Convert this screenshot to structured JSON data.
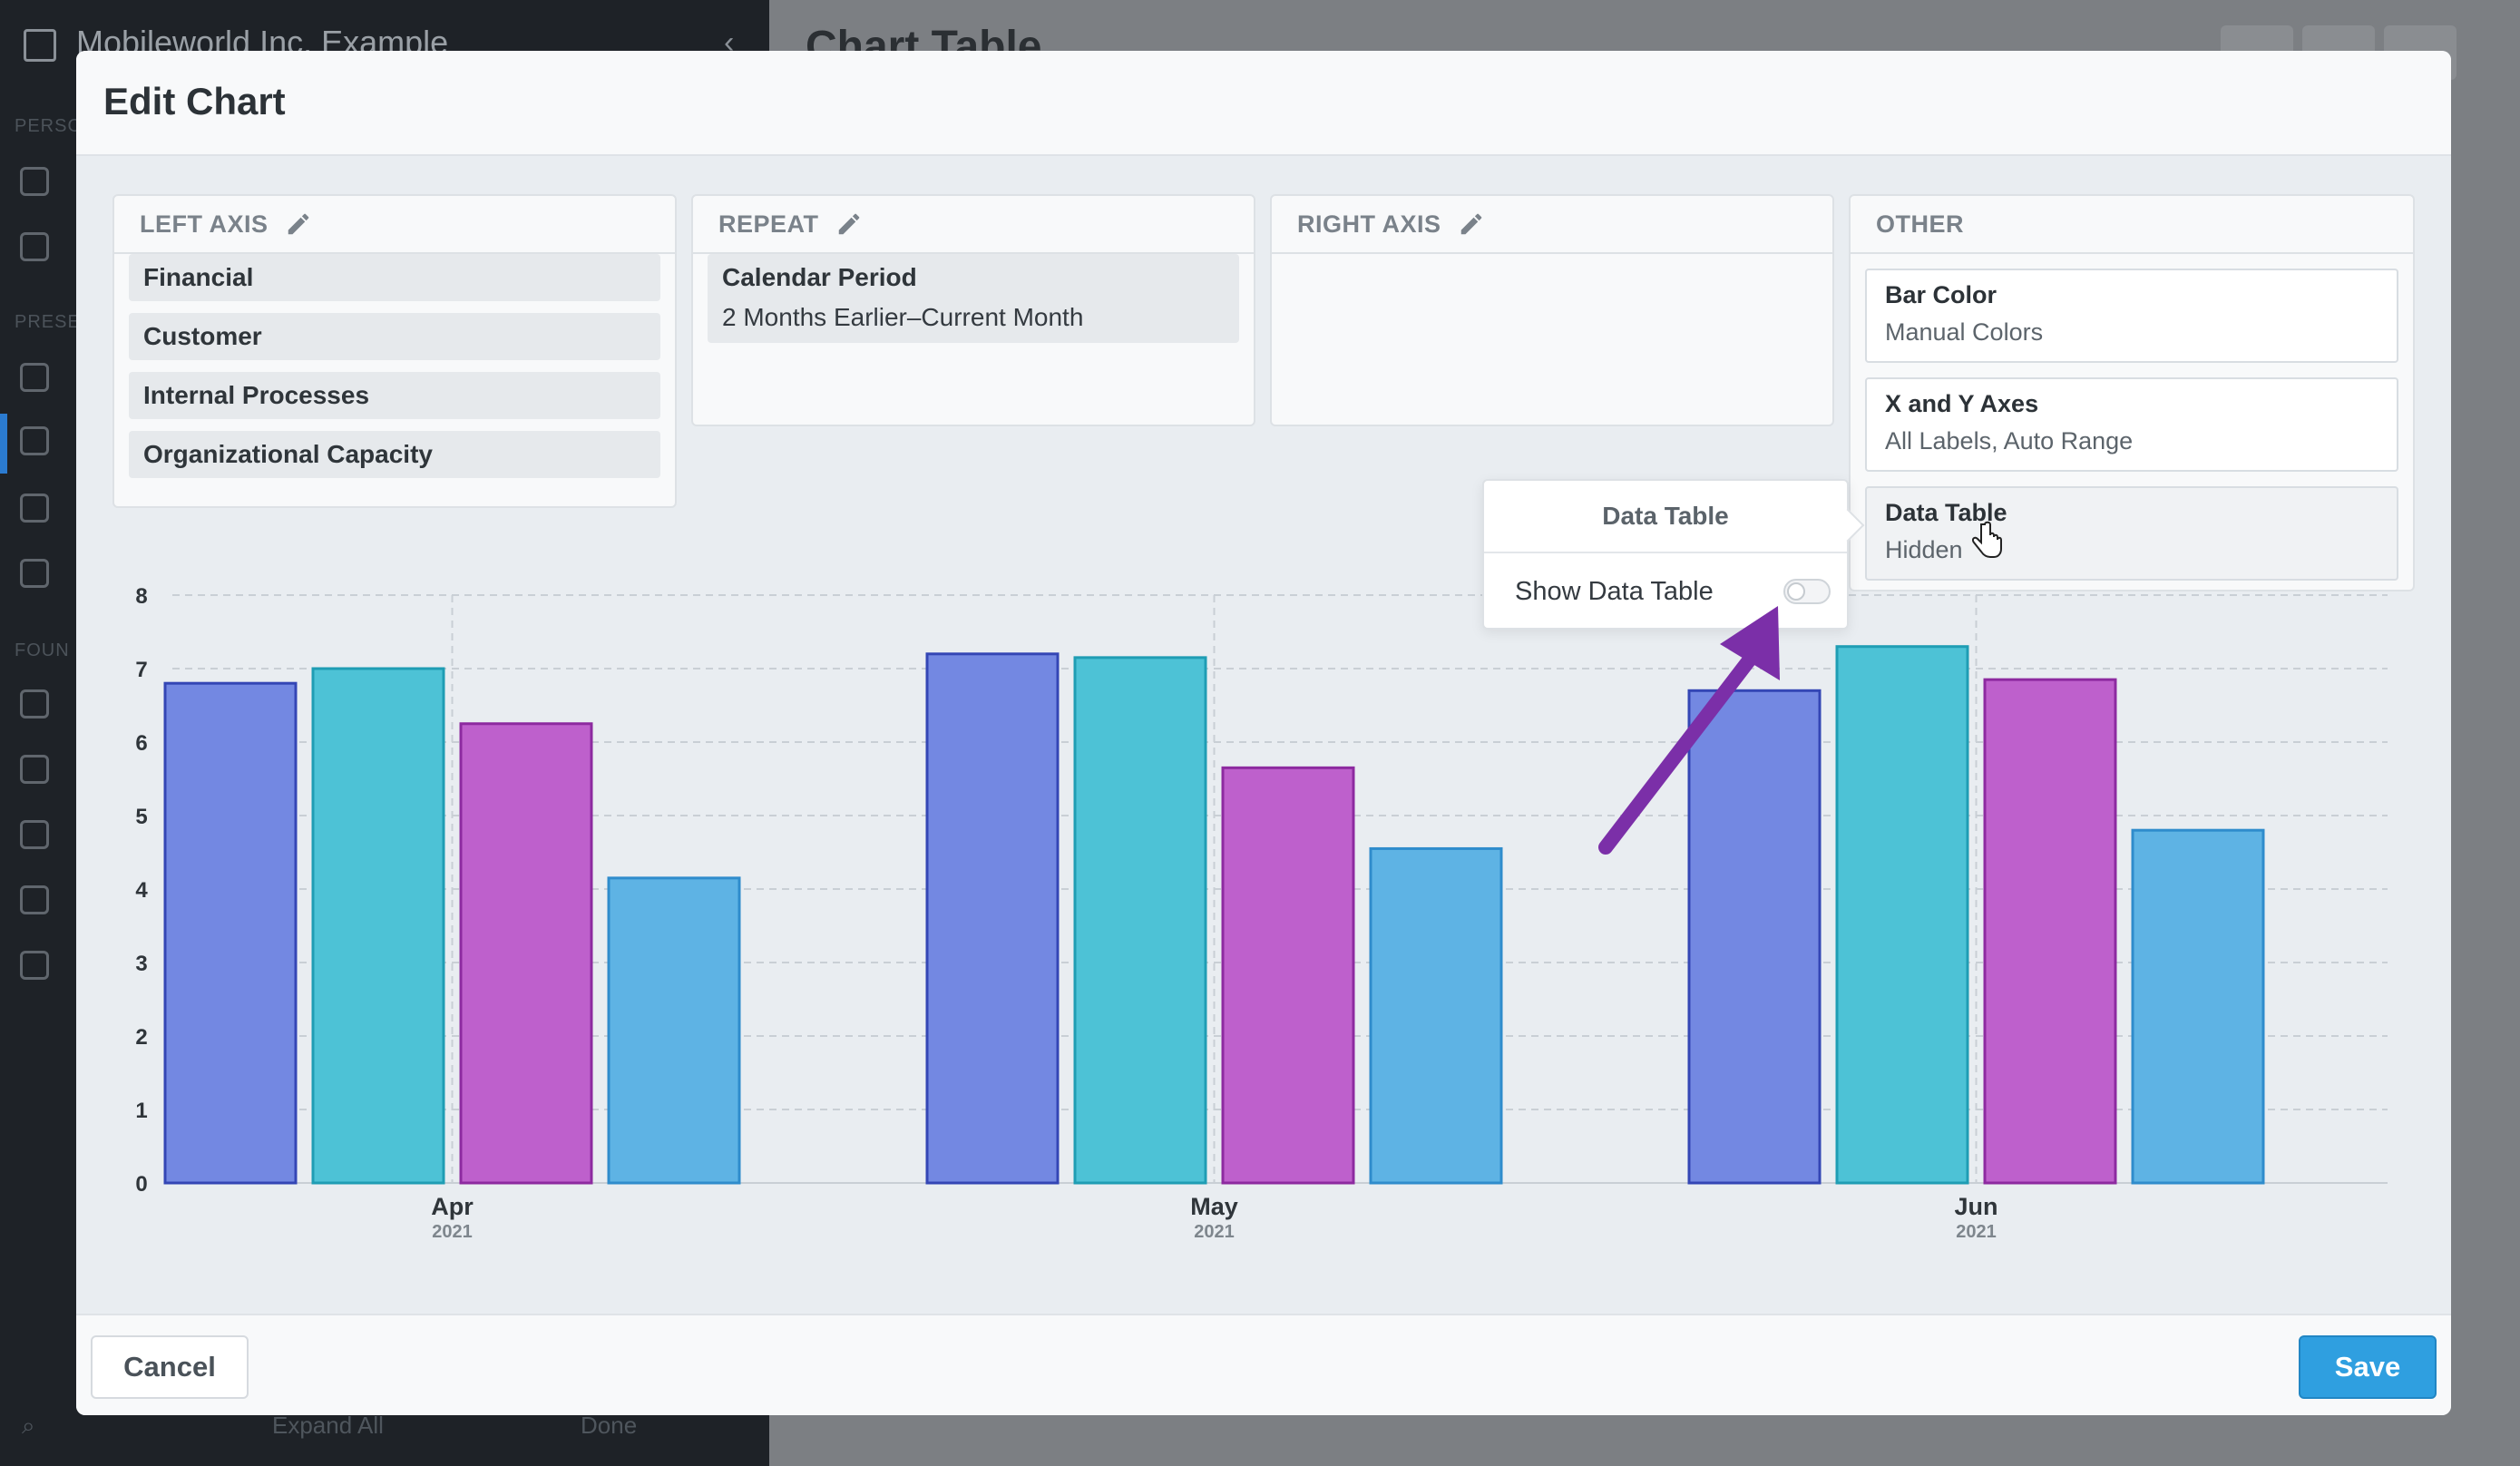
{
  "background": {
    "company_name": "Mobileworld Inc. Example",
    "page_title": "Chart Table",
    "sidebar_sections": [
      "PERSO",
      "PRESE",
      "FOUN"
    ],
    "bottom_expand": "Expand All",
    "bottom_done": "Done"
  },
  "modal": {
    "title": "Edit Chart",
    "cancel_label": "Cancel",
    "save_label": "Save"
  },
  "panels": {
    "left_axis": {
      "title": "LEFT AXIS",
      "items": [
        "Financial",
        "Customer",
        "Internal Processes",
        "Organizational Capacity"
      ]
    },
    "repeat": {
      "title": "REPEAT",
      "item_title": "Calendar Period",
      "item_sub": "2 Months Earlier–Current Month"
    },
    "right_axis": {
      "title": "RIGHT AXIS"
    },
    "other": {
      "title": "OTHER",
      "cards": [
        {
          "title": "Bar Color",
          "sub": "Manual Colors"
        },
        {
          "title": "X and Y Axes",
          "sub": "All Labels, Auto Range"
        },
        {
          "title": "Data Table",
          "sub": "Hidden"
        }
      ]
    }
  },
  "popover": {
    "title": "Data Table",
    "option_label": "Show Data Table",
    "option_enabled": false
  },
  "annotation_color": "#7b2fa8",
  "chart_data": {
    "type": "bar",
    "categories": [
      "Apr",
      "May",
      "Jun"
    ],
    "category_sublabels": [
      "2021",
      "2021",
      "2021"
    ],
    "ylim": [
      0,
      8
    ],
    "yticks": [
      0,
      1,
      2,
      3,
      4,
      5,
      6,
      7,
      8
    ],
    "grid": true,
    "series": [
      {
        "values": [
          6.8,
          7.2,
          6.7
        ],
        "fill": "#7388e2",
        "stroke": "#3446b5"
      },
      {
        "values": [
          7.0,
          7.15,
          7.3
        ],
        "fill": "#4dc2d6",
        "stroke": "#1f9db4"
      },
      {
        "values": [
          6.25,
          5.65,
          6.85
        ],
        "fill": "#be60cc",
        "stroke": "#8d2aa0"
      },
      {
        "values": [
          4.15,
          4.55,
          4.8
        ],
        "fill": "#5eb3e4",
        "stroke": "#2f8ccc"
      }
    ]
  }
}
